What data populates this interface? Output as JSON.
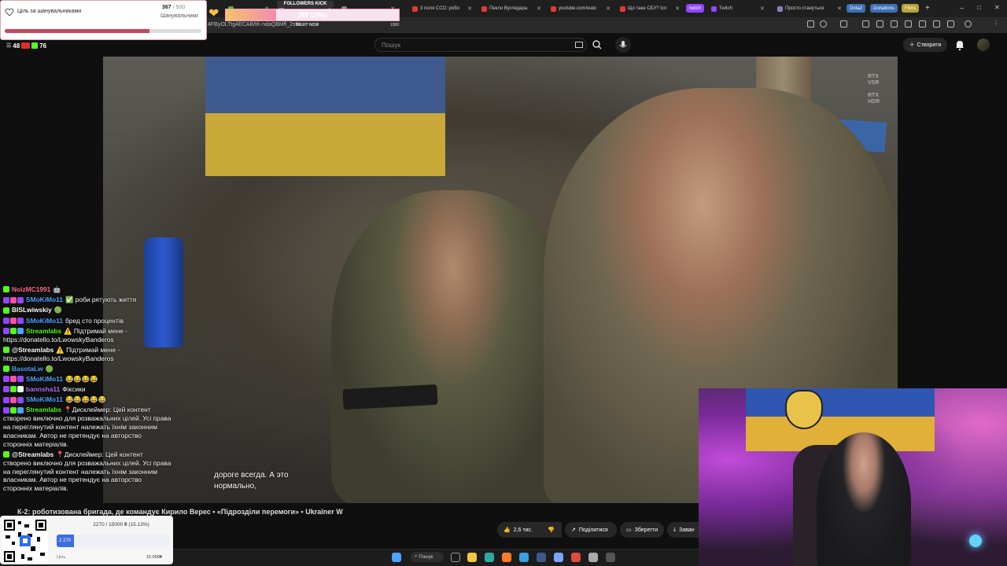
{
  "browser": {
    "tabs": [
      {
        "label": "",
        "color": "#6aa84f"
      },
      {
        "label": "",
        "color": "#888888"
      },
      {
        "label": "",
        "color": "#888888"
      },
      {
        "label": "3 поля CCO: робо",
        "color": "#e53935"
      },
      {
        "label": "Пекло Вугледара",
        "color": "#e53935"
      },
      {
        "label": "youtube.com/watc",
        "color": "#e53935"
      },
      {
        "label": "Що таке СБУ? Ісп",
        "color": "#e53935"
      },
      {
        "label": "Twitch",
        "color": "#9147ff"
      },
      {
        "label": "Просто стануться",
        "color": "#8e7cc3"
      }
    ],
    "bookmark_badges": [
      {
        "label": "twitch",
        "color": "#9147ff"
      },
      {
        "label": "Dota2",
        "color": "#3d6fb6"
      },
      {
        "label": "Donations",
        "color": "#3d6fb6"
      },
      {
        "label": "Films",
        "color": "#b8a339"
      }
    ],
    "url_fragment": "4FByOLTtg4ECAB/tK-ndaQBMfl_2s%"
  },
  "youtube": {
    "search_placeholder": "Пошук",
    "create_label": "Створити"
  },
  "video": {
    "rtx_vsr": "RTX\nVSR",
    "rtx_hdr": "RTX\nHDR",
    "subtitle_line1": "дороге всегда. А это",
    "subtitle_line2": "нормально,",
    "title": "К-2: роботизована бригада, де командує Кирило Верес • «Підрозділи перемоги» • Ukraїner W"
  },
  "actions": {
    "likes": "2,6 тис.",
    "share": "Поділитися",
    "save": "Зберегти",
    "download": "Заван"
  },
  "goal_widget": {
    "title": "Ціль за шанувальниками",
    "current": "367",
    "max": "/ 500",
    "subtitle": "Шанувальники",
    "progress": 0.734
  },
  "kick_widget": {
    "label": "FOLLOWERS KICK",
    "value_text": "289 (28%)",
    "progress": 0.289,
    "sub": "RIGHT NOW",
    "max": "1000"
  },
  "viewers": {
    "youtube": "48",
    "kick": "76"
  },
  "chat": [
    {
      "nick": "NoizMC1991",
      "nick_color": "#ff6a8a",
      "badges": [
        "#53fc18"
      ],
      "text": "🤖"
    },
    {
      "nick": "SMoKiMo11",
      "nick_color": "#4fa3ff",
      "badges": [
        "#9147ff",
        "#ff4fa3",
        "#9147ff"
      ],
      "text": "✅ роби рятують життя"
    },
    {
      "nick": "BISLwiwskiy",
      "nick_color": "#ffffff",
      "badges": [
        "#53fc18"
      ],
      "text": "🟢"
    },
    {
      "nick": "SMoKiMo11",
      "nick_color": "#4fa3ff",
      "badges": [
        "#9147ff",
        "#ff4fa3",
        "#9147ff"
      ],
      "text": "бред сто процентів"
    },
    {
      "nick": "Streamlabs",
      "nick_color": "#53fc18",
      "badges": [
        "#9147ff",
        "#53fc18",
        "#4fa3ff"
      ],
      "text": "⚠️ Підтримай мене - https://donatello.to/LwowskyBanderos"
    },
    {
      "nick": "@Streamlabs",
      "nick_color": "#ffffff",
      "badges": [
        "#53fc18"
      ],
      "text": "⚠️ Підтримай мене - https://donatello.to/LwowskyBanderos"
    },
    {
      "nick": "BasotaLw",
      "nick_color": "#4fa3ff",
      "badges": [
        "#53fc18"
      ],
      "text": "🟢"
    },
    {
      "nick": "SMoKiMo11",
      "nick_color": "#4fa3ff",
      "badges": [
        "#9147ff",
        "#ff4fa3",
        "#9147ff"
      ],
      "text": "😂😂😂😂"
    },
    {
      "nick": "bannsha11",
      "nick_color": "#b36bff",
      "badges": [
        "#9147ff",
        "#53fc18",
        "#ffffff"
      ],
      "text": "Фіксики"
    },
    {
      "nick": "SMoKiMo11",
      "nick_color": "#4fa3ff",
      "badges": [
        "#9147ff",
        "#ff4fa3",
        "#9147ff"
      ],
      "text": "😂😂😂😂😂"
    },
    {
      "nick": "Streamlabs",
      "nick_color": "#53fc18",
      "badges": [
        "#9147ff",
        "#53fc18",
        "#4fa3ff"
      ],
      "text": "📍Дисклеймер: Цей контент створено виключно для розважальних цілей. Усі права на переглянутий контент належать їхнім законним власникам. Автор не претендує на авторство сторонніх матеріалів."
    },
    {
      "nick": "@Streamlabs",
      "nick_color": "#ffffff",
      "badges": [
        "#53fc18"
      ],
      "text": "📍Дисклеймер: Цей контент створено виключно для розважальних цілей. Усі права на переглянутий контент належать їхнім законним власникам. Автор не претендує на авторство сторонніх матеріалів."
    }
  ],
  "donation": {
    "summary": "2270 / 15000 ₴ (15.13%)",
    "current_label": "2 270",
    "progress": 0.1513,
    "min_label": "Ціль",
    "max_label": "15 000₴"
  },
  "taskbar": {
    "search_label": "Пошук",
    "apps": [
      {
        "name": "windows-start-icon",
        "color": "#4aa3ff"
      },
      {
        "name": "task-view-icon",
        "color": "#888888"
      },
      {
        "name": "file-explorer-icon",
        "color": "#f2c744"
      },
      {
        "name": "edge-icon",
        "color": "#2fa9a0"
      },
      {
        "name": "firefox-icon",
        "color": "#ff7a2a"
      },
      {
        "name": "telegram-icon",
        "color": "#3aa0e0"
      },
      {
        "name": "steam-icon",
        "color": "#3a5a8a"
      },
      {
        "name": "app-icon",
        "color": "#7aa4ff"
      },
      {
        "name": "chrome-icon",
        "color": "#e24a3a"
      },
      {
        "name": "settings-icon",
        "color": "#aaaaaa"
      },
      {
        "name": "obs-icon",
        "color": "#555555"
      }
    ]
  }
}
